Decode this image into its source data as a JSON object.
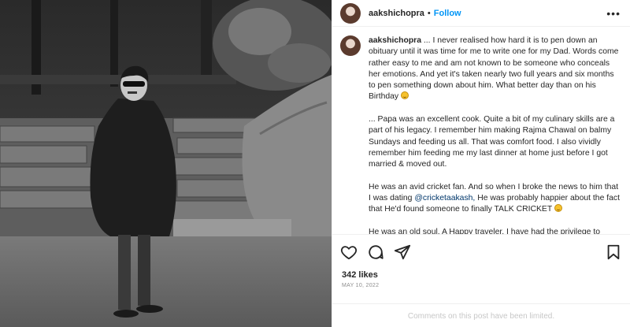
{
  "post": {
    "username": "aakshichopra",
    "follow_label": "Follow",
    "separator": "•",
    "more_label": "•••"
  },
  "caption": {
    "username": "aakshichopra",
    "paragraphs": [
      "... I never realised how hard it is to pen down an obituary until it was time for me to write one for my Dad. Words come rather easy to me and am not known to be someone who conceals her emotions. And yet it's taken nearly two full years and six months to pen something down about him. What better day than on his Birthday",
      "... Papa was an excellent cook. Quite a bit of my culinary skills are a part of his legacy. I remember him making Rajma Chawal on balmy Sundays and feeding us all. That was comfort food. I also vividly remember him feeding me my last dinner at home just before I got married & moved out.",
      "He was an avid cricket fan. And so when I broke the news to him that I was dating",
      "He was probably happier about the fact that He'd found someone to finally TALK CRICKET",
      "He was an old soul. A Happy traveler. I have had the privilege to"
    ],
    "mention": "@cricketaakash,"
  },
  "actions": {
    "like_icon": "heart-icon",
    "comment_icon": "comment-icon",
    "share_icon": "share-icon",
    "save_icon": "bookmark-icon"
  },
  "likes": "342 likes",
  "date": "MAY 10, 2022",
  "comments_limited": "Comments on this post have been limited.",
  "colors": {
    "accent": "#0095f6",
    "text": "#262626",
    "muted": "#8e8e8e"
  }
}
